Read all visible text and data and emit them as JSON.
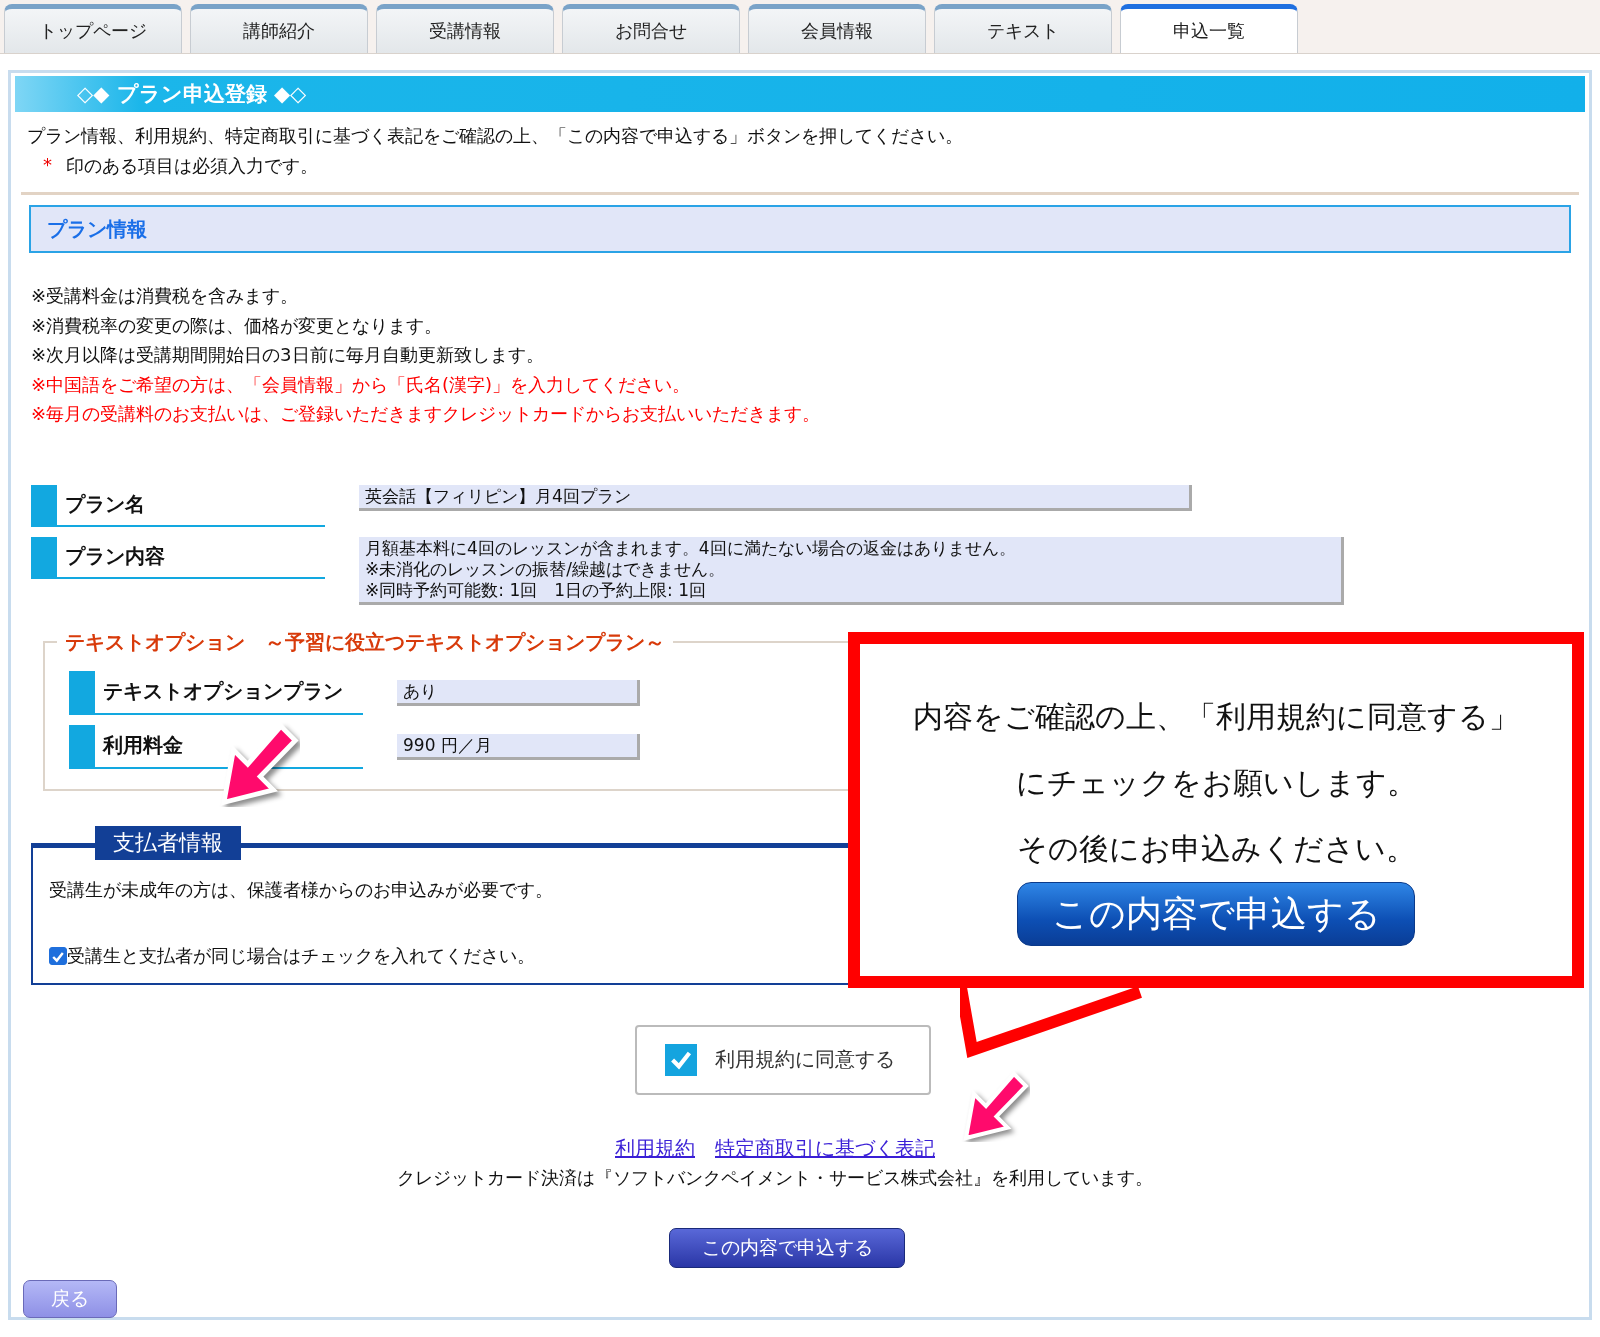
{
  "tabs": [
    {
      "label": "トップページ",
      "selected": false
    },
    {
      "label": "講師紹介",
      "selected": false
    },
    {
      "label": "受講情報",
      "selected": false
    },
    {
      "label": "お問合せ",
      "selected": false
    },
    {
      "label": "会員情報",
      "selected": false
    },
    {
      "label": "テキスト",
      "selected": false
    },
    {
      "label": "申込一覧",
      "selected": true
    }
  ],
  "header": {
    "title": "◇◆ プラン申込登録 ◆◇"
  },
  "intro": "プラン情報、利用規約、特定商取引に基づく表記をご確認の上、「この内容で申込する」ボタンを押してください。",
  "required_note": {
    "mark": "*",
    "text": "印のある項目は必須入力です。"
  },
  "plan_section": {
    "title": "プラン情報",
    "notes": [
      {
        "text": "※受講料金は消費税を含みます。",
        "kind": "normal"
      },
      {
        "text": "※消費税率の変更の際は、価格が変更となります。",
        "kind": "normal"
      },
      {
        "text": "※次月以降は受講期間開始日の3日前に毎月自動更新致します。",
        "kind": "normal"
      },
      {
        "text": "※中国語をご希望の方は、「会員情報」から「氏名(漢字)」を入力してください。",
        "kind": "warning"
      },
      {
        "text": "※毎月の受講料のお支払いは、ご登録いただきますクレジットカードからお支払いいただきます。",
        "kind": "warning"
      }
    ],
    "fields": [
      {
        "label": "プラン名",
        "lines": [
          "英会話【フィリピン】月4回プラン"
        ]
      },
      {
        "label": "プラン内容",
        "lines": [
          "月額基本料に4回のレッスンが含まれます。4回に満たない場合の返金はありません。",
          "※未消化のレッスンの振替/繰越はできません。",
          "※同時予約可能数: 1回　1日の予約上限: 1回"
        ]
      }
    ]
  },
  "text_option": {
    "title": "テキストオプション　～予習に役立つテキストオプションプラン～",
    "fields": [
      {
        "label": "テキストオプションプラン",
        "value": "あり"
      },
      {
        "label": "利用料金",
        "value": "990 円／月"
      }
    ]
  },
  "payer": {
    "title": "支払者情報",
    "note": "受講生が未成年の方は、保護者様からのお申込みが必要です。",
    "same_checkbox": {
      "label": "受講生と支払者が同じ場合はチェックを入れてください。",
      "checked": true
    }
  },
  "agree": {
    "label": "利用規約に同意する",
    "checked": true
  },
  "links": [
    "利用規約",
    "特定商取引に基づく表記"
  ],
  "credit_text": "クレジットカード決済は『ソフトバンクペイメント・サービス株式会社』を利用しています。",
  "submit_button": "この内容で申込する",
  "back_button": "戻る",
  "callout": {
    "lines": [
      "内容をご確認の上、「利用規約に同意する」",
      "にチェックをお願いします。",
      "その後にお申込みください。"
    ],
    "button": "この内容で申込する"
  }
}
